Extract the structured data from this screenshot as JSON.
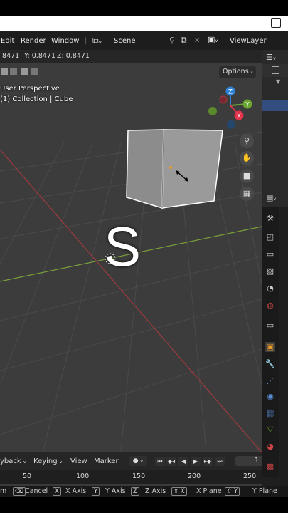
{
  "menubar": {
    "items": [
      "Edit",
      "Render",
      "Window"
    ],
    "scene_label": "Scene",
    "viewlayer_label": "ViewLayer"
  },
  "header": {
    "coords_x": ".8471",
    "coords_y": "Y: 0.8471",
    "coords_z": "Z: 0.8471",
    "options_label": "Options"
  },
  "viewport": {
    "view_name": "User Perspective",
    "collection_info": "(1) Collection | Cube",
    "overlay_key": "S"
  },
  "gizmo": {
    "x_label": "X",
    "y_label": "Y",
    "z_label": "Z",
    "colors": {
      "x": "#e0324a",
      "y": "#6aa431",
      "z": "#2f81d6"
    }
  },
  "timeline": {
    "playback_label": "ybackᵥ",
    "playback": "yback",
    "keying": "Keying",
    "view": "View",
    "marker": "Marker",
    "current_frame": "1",
    "ruler_ticks": [
      "50",
      "100",
      "150",
      "200",
      "250"
    ]
  },
  "statusbar": {
    "items": [
      {
        "key": "",
        "label": "m"
      },
      {
        "key": "",
        "label": "Cancel"
      },
      {
        "key": "X",
        "label": "X Axis"
      },
      {
        "key": "Y",
        "label": "Y Axis"
      },
      {
        "key": "Z",
        "label": "Z Axis"
      },
      {
        "key": "⇧ X",
        "label": "X Plane"
      },
      {
        "key": "⇧ Y",
        "label": "Y Plane"
      }
    ]
  },
  "accent": "#e69a28"
}
